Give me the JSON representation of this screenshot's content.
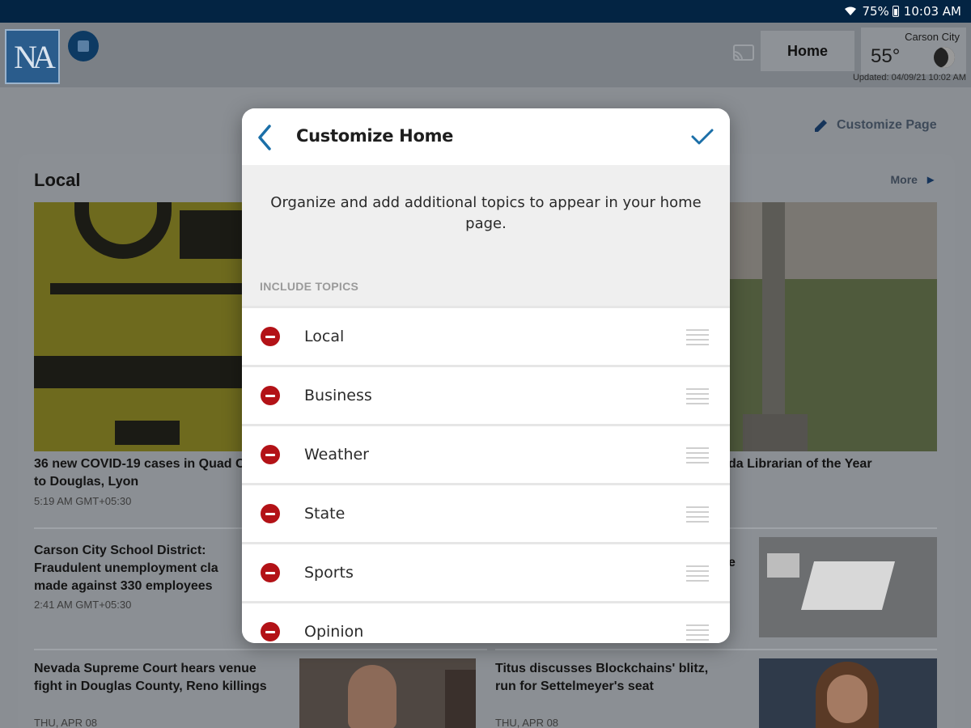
{
  "status_bar": {
    "battery": "75%",
    "time": "10:03 AM"
  },
  "app": {
    "logo": "NA",
    "nav": {
      "home_label": "Home"
    },
    "weather": {
      "city": "Carson City",
      "temp": "55°",
      "updated": "Updated: 04/09/21 10:02 AM"
    },
    "customize_link": "Customize Page",
    "section": {
      "title": "Local",
      "more": "More",
      "articles": [
        {
          "headline_l1": "36 new COVID-19 cases in Quad C",
          "headline_l2": "to Douglas, Lyon",
          "time": "5:19 AM GMT+05:30"
        },
        {
          "headline_l1": "da Librarian of the Year"
        },
        {
          "headline_l1": "Carson City School District:",
          "headline_l2": "Fraudulent unemployment cla",
          "headline_l3": "made against 330 employees",
          "time": "2:41 AM GMT+05:30"
        },
        {
          "headline_l1": "e"
        },
        {
          "headline_l1": "Nevada Supreme Court hears venue",
          "headline_l2": "fight in Douglas County, Reno killings",
          "time": "THU, APR 08"
        },
        {
          "headline_l1": "Titus discusses Blockchains' blitz,",
          "headline_l2": "run for Settelmeyer's seat",
          "time": "THU, APR 08"
        }
      ]
    }
  },
  "modal": {
    "title": "Customize Home",
    "intro": "Organize and add additional topics to appear in your home page.",
    "section_label": "INCLUDE TOPICS",
    "topics": [
      "Local",
      "Business",
      "Weather",
      "State",
      "Sports",
      "Opinion"
    ]
  },
  "colors": {
    "status_bar": "#032443",
    "accent": "#1b6fa8",
    "remove": "#b31217"
  }
}
